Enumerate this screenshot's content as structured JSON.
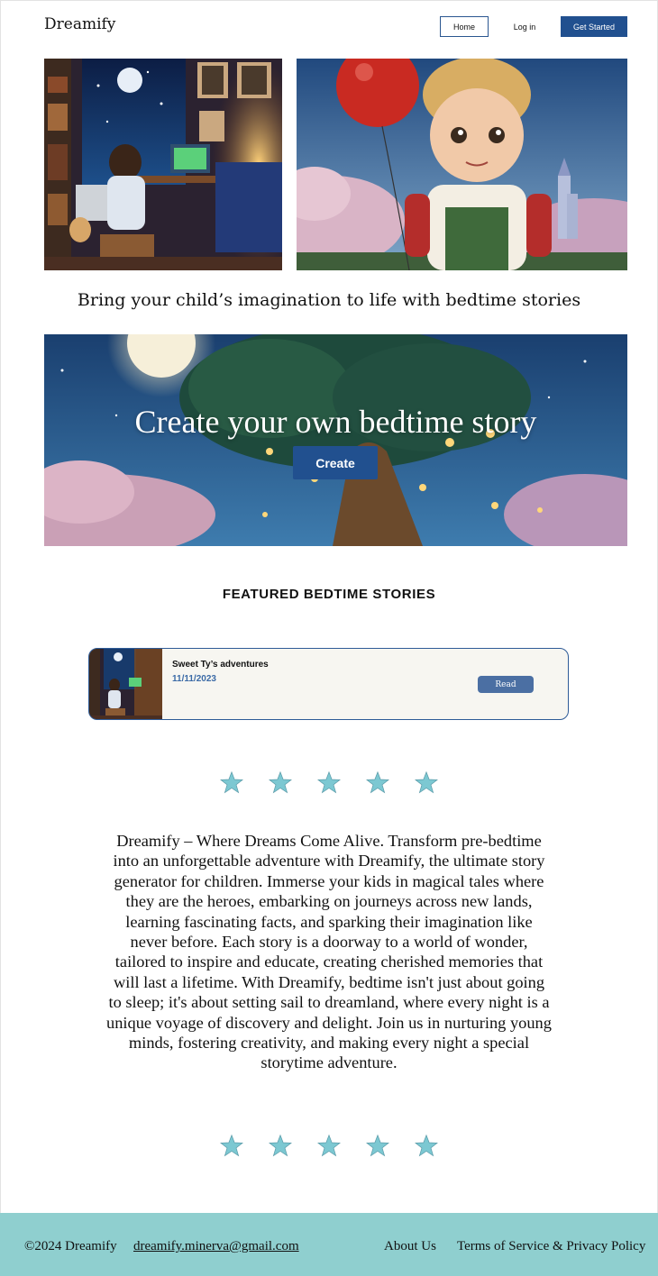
{
  "header": {
    "logo": "Dreamify",
    "nav": {
      "home": "Home",
      "login": "Log in",
      "get_started": "Get Started"
    }
  },
  "hero": {
    "tagline": "Bring your child’s imagination to life with bedtime stories"
  },
  "banner": {
    "title": "Create your own bedtime story",
    "button": "Create"
  },
  "featured": {
    "heading": "FEATURED BEDTIME STORIES",
    "stories": [
      {
        "title": "Sweet Ty’s adventures",
        "date": "11/11/2023",
        "action": "Read"
      }
    ]
  },
  "rating_stars": 5,
  "description": "Dreamify – Where Dreams Come Alive. Transform pre-bedtime into an unforgettable adventure with Dreamify, the ultimate story generator for children. Immerse your kids in magical tales where they are the heroes, embarking on journeys across new lands, learning fascinating facts, and sparking their imagination like never before. Each story is a doorway to a world of wonder, tailored to inspire and educate, creating cherished memories that will last a lifetime. With Dreamify, bedtime isn't just about going to sleep; it's about setting sail to dreamland, where every night is a unique voyage of discovery and delight. Join us in nurturing young minds, fostering creativity, and making every night a special storytime adventure.",
  "footer": {
    "copyright": "©2024 Dreamify",
    "email": "dreamify.minerva@gmail.com",
    "about": "About Us",
    "terms": "Terms of Service & Privacy Policy"
  },
  "colors": {
    "primary": "#21508f",
    "footer_bg": "#8fcfcf",
    "star": "#7cc8d2",
    "card_border": "#2e5b97"
  }
}
